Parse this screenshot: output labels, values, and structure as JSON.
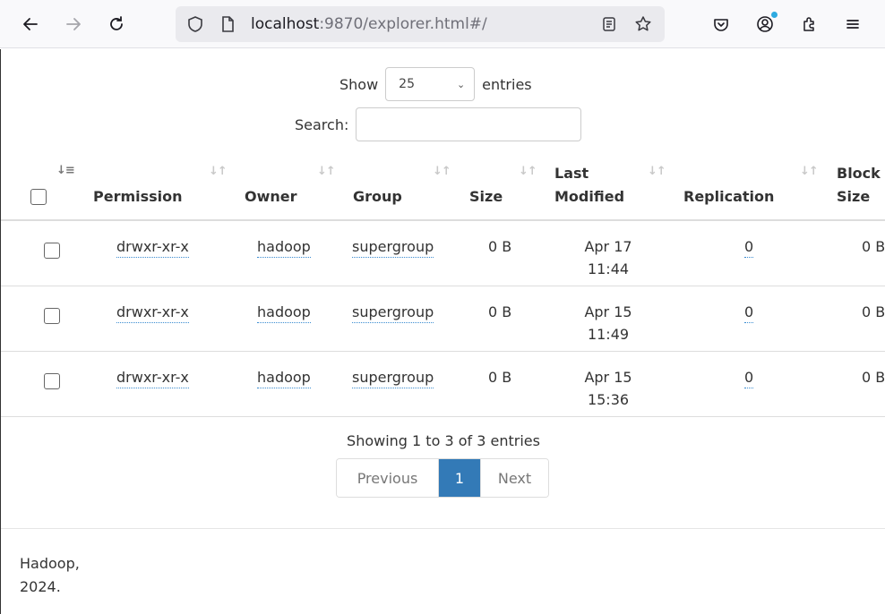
{
  "browser": {
    "url_host": "localhost",
    "url_rest": ":9870/explorer.html#/"
  },
  "length": {
    "show_label": "Show",
    "value": "25",
    "entries_label": "entries"
  },
  "search": {
    "label": "Search:",
    "value": "",
    "placeholder": ""
  },
  "table": {
    "columns": [
      {
        "label": "Permission"
      },
      {
        "label": "Owner"
      },
      {
        "label": "Group"
      },
      {
        "label": "Size"
      },
      {
        "label_line1": "Last",
        "label_line2": "Modified"
      },
      {
        "label": "Replication"
      },
      {
        "label_line1": "Block",
        "label_line2": "Size"
      }
    ],
    "rows": [
      {
        "permission": "drwxr-xr-x",
        "owner": "hadoop",
        "group": "supergroup",
        "size": "0 B",
        "date": "Apr 17",
        "time": "11:44",
        "replication": "0",
        "block_size": "0 B"
      },
      {
        "permission": "drwxr-xr-x",
        "owner": "hadoop",
        "group": "supergroup",
        "size": "0 B",
        "date": "Apr 15",
        "time": "11:49",
        "replication": "0",
        "block_size": "0 B"
      },
      {
        "permission": "drwxr-xr-x",
        "owner": "hadoop",
        "group": "supergroup",
        "size": "0 B",
        "date": "Apr 15",
        "time": "15:36",
        "replication": "0",
        "block_size": "0 B"
      }
    ]
  },
  "info": "Showing 1 to 3 of 3 entries",
  "pagination": {
    "previous": "Previous",
    "current": "1",
    "next": "Next"
  },
  "footer": {
    "line1": "Hadoop,",
    "line2": "2024."
  },
  "colors": {
    "accent": "#337ab7",
    "link_underline": "#3a8bd0"
  },
  "icons": [
    "back-arrow-icon",
    "forward-arrow-icon",
    "reload-icon",
    "shield-icon",
    "page-icon",
    "reader-mode-icon",
    "bookmark-star-icon",
    "pocket-icon",
    "account-icon",
    "extensions-icon",
    "menu-icon",
    "sort-icon",
    "chevron-down-icon"
  ]
}
